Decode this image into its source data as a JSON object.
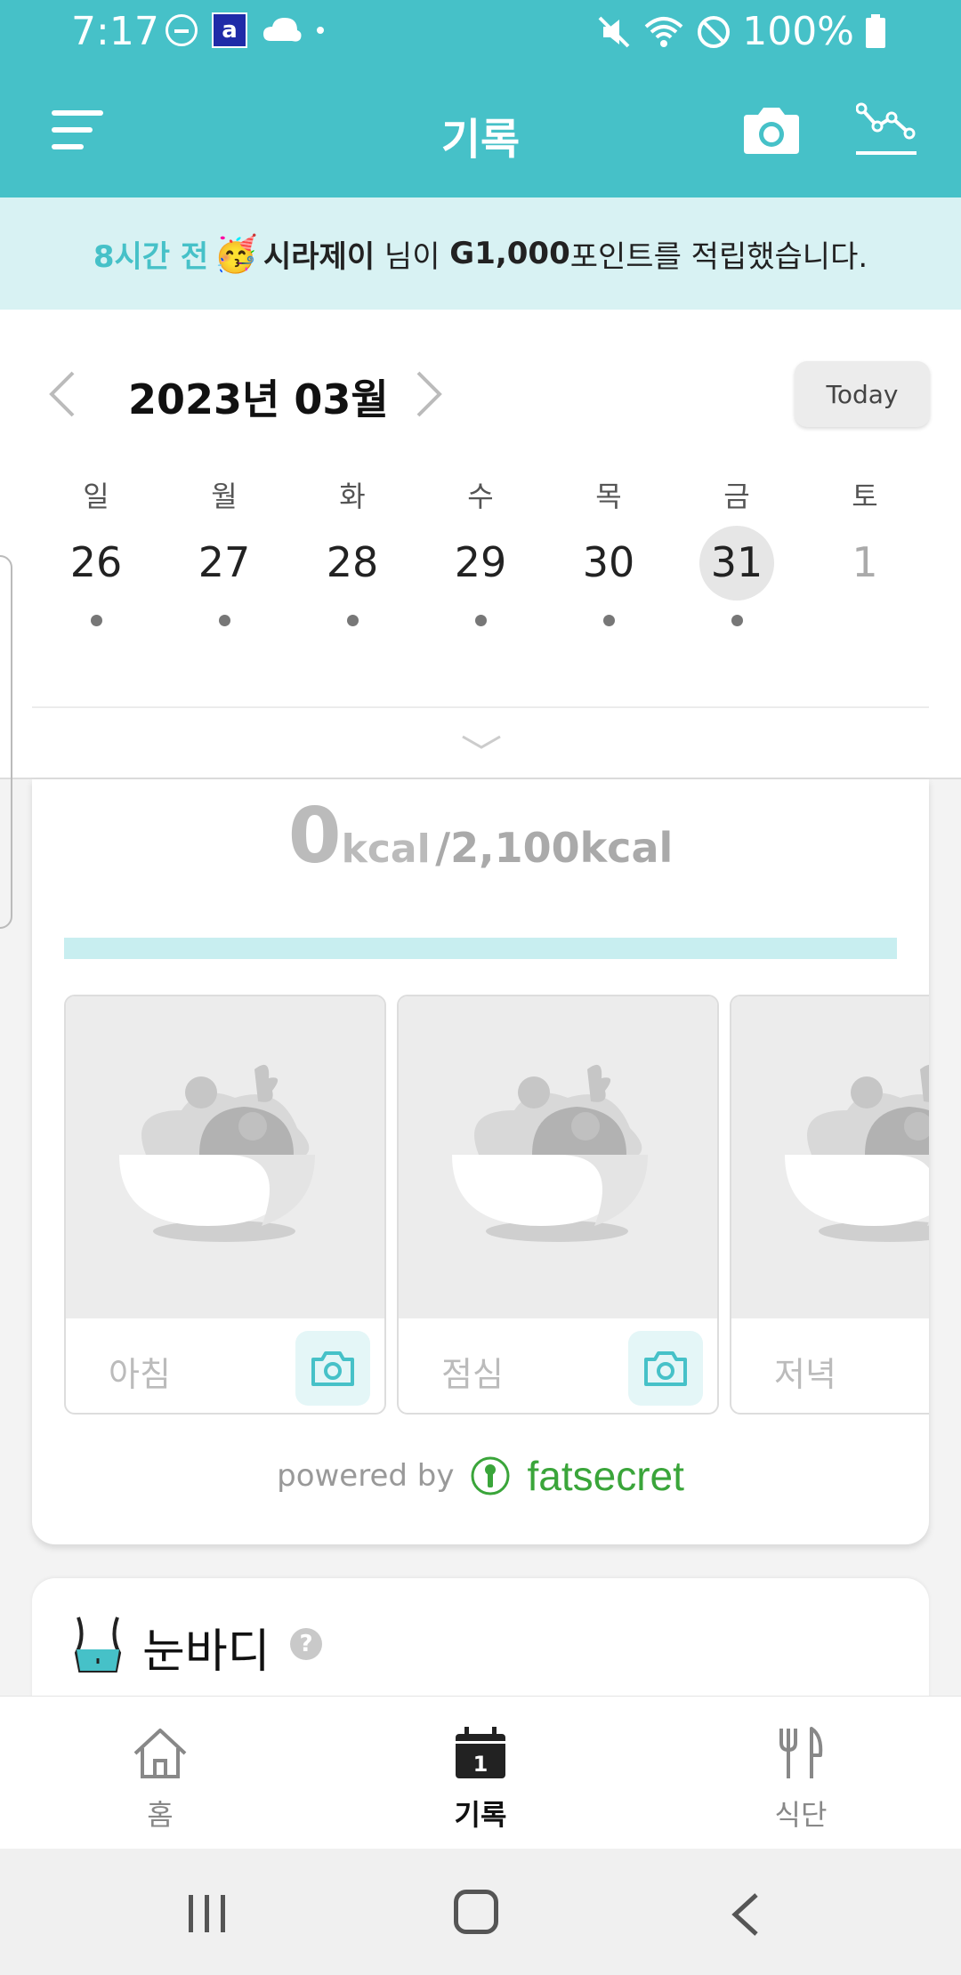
{
  "status_bar": {
    "time": "7:17",
    "app_icon_letter": "a",
    "battery": "100%"
  },
  "header": {
    "title": "기록",
    "icons": [
      "menu-icon",
      "camera-icon",
      "trend-icon"
    ]
  },
  "notification": {
    "time_ago": "8시간 전",
    "emoji": "🥳",
    "user": "시라제이",
    "honorific": " 님이 ",
    "points": "G1,000",
    "message": "포인트를 적립했습니다."
  },
  "calendar": {
    "month_label": "2023년 03월",
    "today_label": "Today",
    "days": [
      {
        "weekday": "일",
        "date": "26",
        "has_dot": true,
        "selected": false,
        "dimmed": false
      },
      {
        "weekday": "월",
        "date": "27",
        "has_dot": true,
        "selected": false,
        "dimmed": false
      },
      {
        "weekday": "화",
        "date": "28",
        "has_dot": true,
        "selected": false,
        "dimmed": false
      },
      {
        "weekday": "수",
        "date": "29",
        "has_dot": true,
        "selected": false,
        "dimmed": false
      },
      {
        "weekday": "목",
        "date": "30",
        "has_dot": true,
        "selected": false,
        "dimmed": false
      },
      {
        "weekday": "금",
        "date": "31",
        "has_dot": true,
        "selected": true,
        "dimmed": false
      },
      {
        "weekday": "토",
        "date": "1",
        "has_dot": false,
        "selected": false,
        "dimmed": true
      }
    ]
  },
  "calories": {
    "consumed": "0",
    "unit": "kcal",
    "goal_text": "/2,100kcal",
    "progress_fraction": 0
  },
  "meals": [
    {
      "label": "아침",
      "has_camera": true
    },
    {
      "label": "점심",
      "has_camera": true
    },
    {
      "label": "저녁",
      "has_camera": true
    }
  ],
  "powered_by": {
    "prefix": "powered by",
    "brand": "fatsecret"
  },
  "body_section": {
    "title": "눈바디",
    "help": "?"
  },
  "tabs": [
    {
      "label": "홈",
      "icon": "home-icon",
      "active": false
    },
    {
      "label": "기록",
      "icon": "calendar-icon",
      "active": true
    },
    {
      "label": "식단",
      "icon": "utensils-icon",
      "active": false
    }
  ],
  "calendar_tab_day": "1",
  "colors": {
    "brand": "#46c1c8",
    "notice_bg": "#d8f2f3",
    "progress_bg": "#c8eef0",
    "fatsecret_green": "#3aa53a"
  }
}
